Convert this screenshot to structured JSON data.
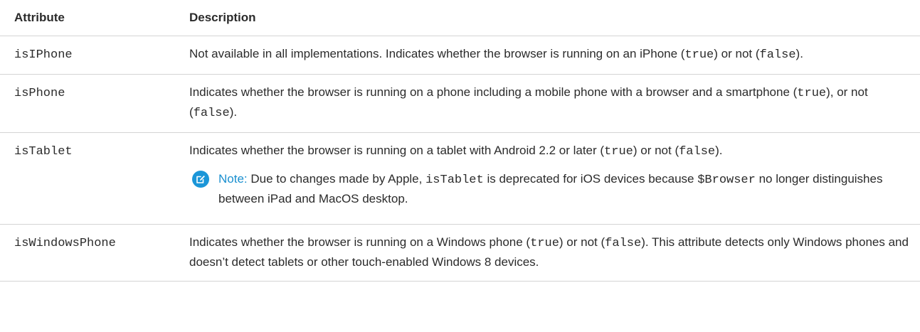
{
  "header": {
    "attribute": "Attribute",
    "description": "Description"
  },
  "rows": [
    {
      "name": "isIPhone",
      "desc_prefix": "Not available in all implementations. Indicates whether the browser is running on an iPhone (",
      "code_true": "true",
      "desc_middle": ") or not (",
      "code_false": "false",
      "desc_suffix": ")."
    },
    {
      "name": "isPhone",
      "desc_prefix": "Indicates whether the browser is running on a phone including a mobile phone with a browser and a smartphone (",
      "code_true": "true",
      "desc_middle": "), or not (",
      "code_false": "false",
      "desc_suffix": ")."
    },
    {
      "name": "isTablet",
      "desc_prefix": "Indicates whether the browser is running on a tablet with Android 2.2 or later (",
      "code_true": "true",
      "desc_middle": ") or not (",
      "code_false": "false",
      "desc_suffix": ").",
      "note": {
        "icon": "edit-note-icon",
        "label": "Note:",
        "text_a": " Due to changes made by Apple, ",
        "code_a": "isTablet",
        "text_b": " is deprecated for iOS devices because ",
        "code_b": "$Browser",
        "text_c": " no longer distinguishes between iPad and MacOS desktop."
      }
    },
    {
      "name": "isWindowsPhone",
      "desc_prefix": "Indicates whether the browser is running on a Windows phone (",
      "code_true": "true",
      "desc_middle": ") or not (",
      "code_false": "false",
      "desc_suffix": "). This attribute detects only Windows phones and doesn’t detect tablets or other touch-enabled Windows 8 devices."
    }
  ]
}
